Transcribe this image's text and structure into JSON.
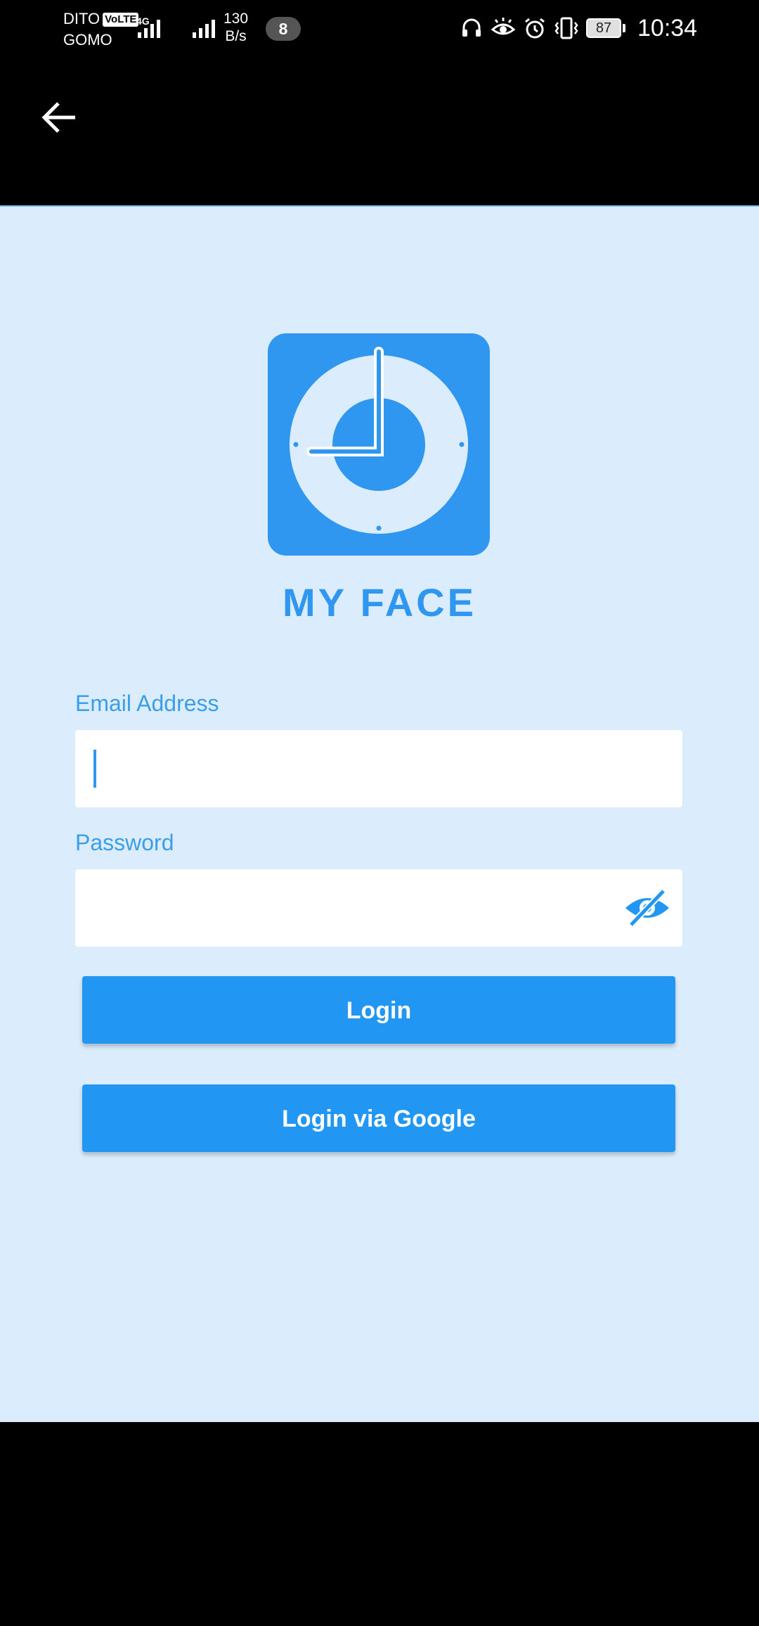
{
  "status_bar": {
    "carrier_line1": "DITO",
    "volte_badge": "VoLTE",
    "carrier_line2": "GOMO",
    "network_type": "4G",
    "speed_value": "130",
    "speed_unit": "B/s",
    "notification_count": "8",
    "battery_level": "87",
    "time": "10:34",
    "icons": [
      "headphones-icon",
      "eye-comfort-icon",
      "alarm-icon",
      "vibrate-icon",
      "battery-icon"
    ]
  },
  "app_bar": {
    "back_icon": "arrow-left-icon"
  },
  "brand": {
    "logo_icon": "clock-face-icon",
    "name": "MY FACE",
    "color": "#2f97f0"
  },
  "form": {
    "email_label": "Email Address",
    "email_value": "",
    "password_label": "Password",
    "password_value": "",
    "password_toggle_icon": "eye-off-icon",
    "login_button": "Login",
    "google_button": "Login via Google"
  },
  "colors": {
    "background": "#dbecfc",
    "accent": "#2196f3",
    "label": "#3a9ee8"
  }
}
